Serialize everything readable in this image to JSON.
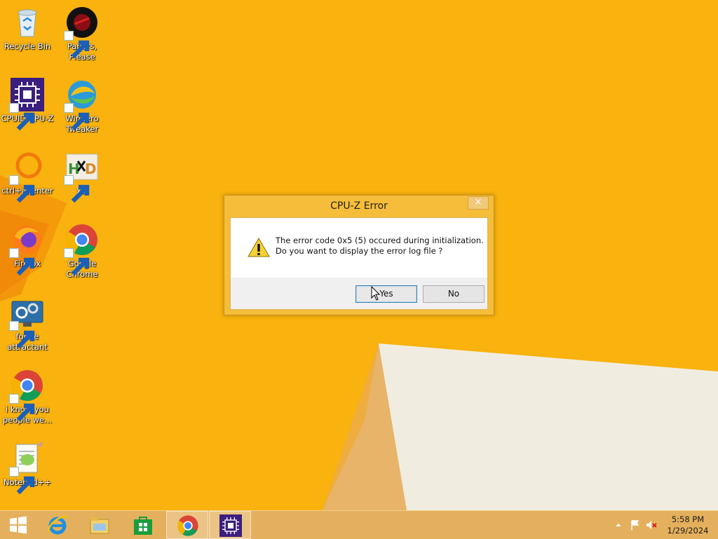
{
  "desktop": {
    "icons": [
      {
        "label": "Recycle Bin",
        "icon": "recycle-bin-icon"
      },
      {
        "label": "Papers, Please",
        "icon": "papers-please-icon"
      },
      {
        "label": "CPUID CPU-Z",
        "icon": "cpuz-icon"
      },
      {
        "label": "Winaero Tweaker",
        "icon": "winaero-tweaker-icon"
      },
      {
        "label": "ctrl+a, enter",
        "icon": "orange-ring-icon"
      },
      {
        "label": "xD",
        "icon": "hxd-icon"
      },
      {
        "label": "Firefox",
        "icon": "firefox-icon"
      },
      {
        "label": "Google Chrome",
        "icon": "chrome-icon"
      },
      {
        "label": "forkie attractant",
        "icon": "gear-monitor-icon"
      },
      {
        "label": "i know you people we...",
        "icon": "chrome-icon"
      },
      {
        "label": "Notepad++",
        "icon": "notepad-plus-plus-icon"
      }
    ]
  },
  "dialog": {
    "title": "CPU-Z Error",
    "close_label": "×",
    "message_line1": "The error code 0x5 (5) occured during initialization.",
    "message_line2": "Do you want to display the error log file ?",
    "yes_label": "Yes",
    "no_label": "No"
  },
  "taskbar": {
    "items": [
      "start-icon",
      "internet-explorer-icon",
      "file-explorer-icon",
      "store-icon",
      "chrome-icon",
      "cpuz-icon"
    ],
    "clock_time": "5:58 PM",
    "clock_date": "1/29/2024"
  },
  "colors": {
    "wallpaper": "#f8b40a",
    "accent": "#f6bd3a"
  }
}
